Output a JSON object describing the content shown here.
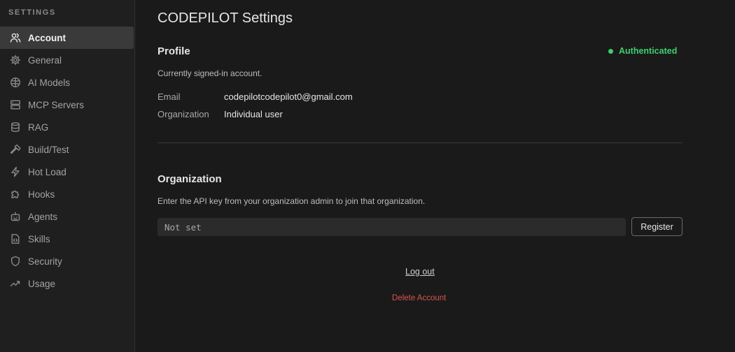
{
  "sidebar": {
    "header": "SETTINGS",
    "items": [
      {
        "label": "Account",
        "icon": "users-icon",
        "active": true
      },
      {
        "label": "General",
        "icon": "gear-icon"
      },
      {
        "label": "AI Models",
        "icon": "brain-icon"
      },
      {
        "label": "MCP Servers",
        "icon": "server-icon"
      },
      {
        "label": "RAG",
        "icon": "database-icon"
      },
      {
        "label": "Build/Test",
        "icon": "hammer-icon"
      },
      {
        "label": "Hot Load",
        "icon": "lightning-icon"
      },
      {
        "label": "Hooks",
        "icon": "puzzle-icon"
      },
      {
        "label": "Agents",
        "icon": "robot-icon"
      },
      {
        "label": "Skills",
        "icon": "file-code-icon"
      },
      {
        "label": "Security",
        "icon": "shield-icon"
      },
      {
        "label": "Usage",
        "icon": "trend-icon"
      }
    ]
  },
  "main": {
    "title": "CODEPILOT Settings",
    "profile": {
      "title": "Profile",
      "status": "Authenticated",
      "status_color": "#3ecf6e",
      "description": "Currently signed-in account.",
      "email_label": "Email",
      "email_value": "codepilotcodepilot0@gmail.com",
      "org_label": "Organization",
      "org_value": "Individual user"
    },
    "organization": {
      "title": "Organization",
      "description": "Enter the API key from your organization admin to join that organization.",
      "input_placeholder": "Not set",
      "register_label": "Register"
    },
    "logout_label": "Log out",
    "delete_label": "Delete Account",
    "delete_color": "#d9534f"
  }
}
